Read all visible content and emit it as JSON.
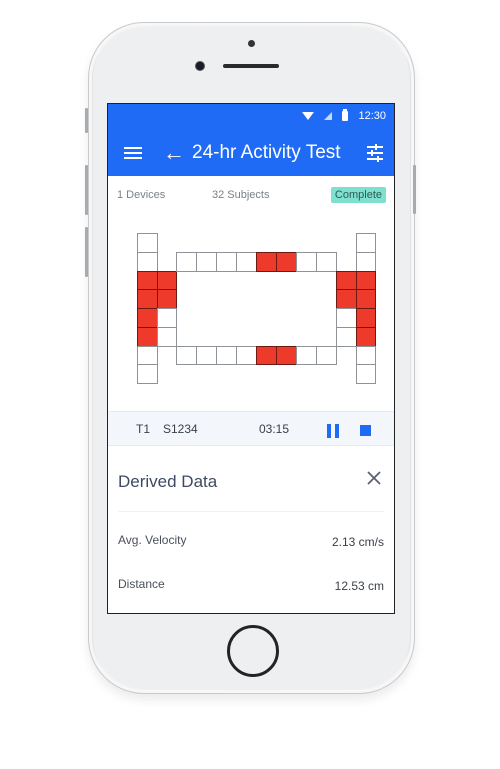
{
  "status_bar": {
    "time": "12:30",
    "icons": [
      "wifi-icon",
      "signal-icon",
      "battery-icon"
    ]
  },
  "app_bar": {
    "menu_icon": "menu-icon",
    "back_icon": "arrow-back-icon",
    "back_glyph": "←",
    "title": "24-hr Activity Test",
    "settings_icon": "tune-icon"
  },
  "summary": {
    "devices": "1 Devices",
    "subjects": "32 Subjects",
    "status_badge": "Complete",
    "status_color": "#7fe0d0"
  },
  "maze": {
    "active_color": "#ee3a2b",
    "left_outer": [
      false,
      false,
      true,
      true,
      true,
      true,
      false,
      false
    ],
    "left_inner": [
      true,
      true,
      false,
      false
    ],
    "top_row": [
      false,
      false,
      false,
      false,
      true,
      true,
      false,
      false
    ],
    "bottom_row": [
      false,
      false,
      false,
      false,
      true,
      true,
      false,
      false
    ],
    "right_inner": [
      true,
      true,
      false,
      false
    ],
    "right_outer": [
      false,
      false,
      true,
      true,
      true,
      true,
      false,
      false
    ]
  },
  "control_bar": {
    "trial": "T1",
    "subject": "S1234",
    "timer": "03:15",
    "pause_icon": "pause-icon",
    "stop_icon": "stop-icon",
    "accent_color": "#1f6bf5"
  },
  "derived_data": {
    "title": "Derived Data",
    "close_icon": "close-icon",
    "rows": [
      {
        "label": "Avg. Velocity",
        "value": "2.13 cm/s"
      },
      {
        "label": "Distance",
        "value": "12.53 cm"
      }
    ]
  }
}
